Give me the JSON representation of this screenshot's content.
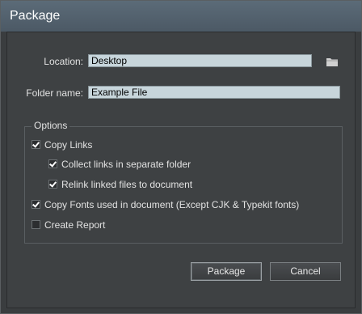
{
  "window": {
    "title": "Package"
  },
  "location": {
    "label": "Location:",
    "value": "Desktop"
  },
  "folder_name": {
    "label": "Folder name:",
    "value": "Example File"
  },
  "options": {
    "title": "Options",
    "items": [
      {
        "label": "Copy Links",
        "checked": true
      },
      {
        "label": "Collect links in separate folder",
        "checked": true
      },
      {
        "label": "Relink linked files to document",
        "checked": true
      },
      {
        "label": "Copy Fonts used in document (Except CJK & Typekit fonts)",
        "checked": true
      },
      {
        "label": "Create Report",
        "checked": false
      }
    ]
  },
  "buttons": {
    "package": "Package",
    "cancel": "Cancel"
  },
  "icons": {
    "browse": "folder-icon"
  }
}
